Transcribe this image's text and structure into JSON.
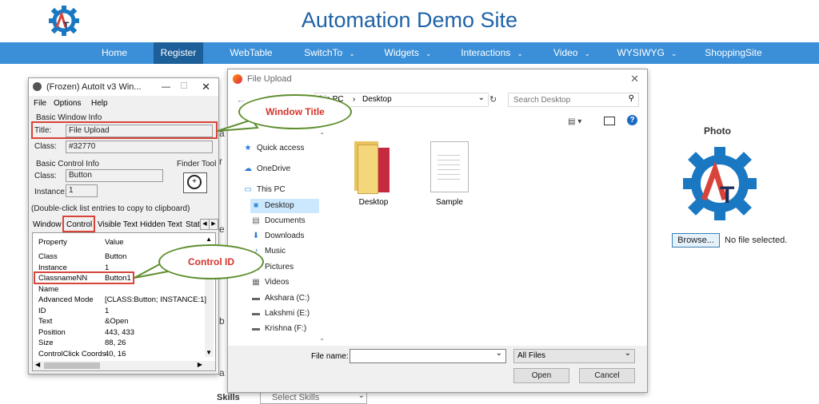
{
  "site": {
    "title": "Automation Demo Site",
    "logo_letters": "AT",
    "nav": [
      {
        "label": "Home",
        "chevron": false
      },
      {
        "label": "Register",
        "chevron": false
      },
      {
        "label": "WebTable",
        "chevron": false
      },
      {
        "label": "SwitchTo",
        "chevron": true
      },
      {
        "label": "Widgets",
        "chevron": true
      },
      {
        "label": "Interactions",
        "chevron": true
      },
      {
        "label": "Video",
        "chevron": true
      },
      {
        "label": "WYSIWYG",
        "chevron": true
      },
      {
        "label": "ShoppingSite",
        "chevron": false
      }
    ],
    "photo_label": "Photo",
    "browse_button": "Browse...",
    "no_file": "No file selected.",
    "skills_label": "Skills",
    "skills_select": "Select Skills"
  },
  "autoit": {
    "title": "(Frozen) AutoIt v3 Win...",
    "menu": [
      "File",
      "Options",
      "Help"
    ],
    "basic_window_info": "Basic Window Info",
    "title_label": "Title:",
    "title_value": "File Upload",
    "class_label": "Class:",
    "class_value": "#32770",
    "basic_control_info": "Basic Control Info",
    "ctrl_class_label": "Class:",
    "ctrl_class_value": "Button",
    "instance_label": "Instance:",
    "instance_value": "1",
    "finder_tool": "Finder Tool",
    "hint": "(Double-click list entries to copy to clipboard)",
    "tabs": [
      "Window",
      "Control",
      "Visible Text",
      "Hidden Text",
      "Stat"
    ],
    "col_property": "Property",
    "col_value": "Value",
    "rows": [
      {
        "property": "Class",
        "value": "Button"
      },
      {
        "property": "Instance",
        "value": "1"
      },
      {
        "property": "ClassnameNN",
        "value": "Button1"
      },
      {
        "property": "Name",
        "value": ""
      },
      {
        "property": "Advanced Mode",
        "value": "[CLASS:Button; INSTANCE:1]"
      },
      {
        "property": "ID",
        "value": "1"
      },
      {
        "property": "Text",
        "value": "&Open"
      },
      {
        "property": "Position",
        "value": "443, 433"
      },
      {
        "property": "Size",
        "value": "88, 26"
      },
      {
        "property": "ControlClick Coords",
        "value": "40, 16"
      }
    ]
  },
  "callouts": {
    "window_title": "Window Title",
    "control_id": "Control ID"
  },
  "dialog": {
    "title": "File Upload",
    "breadcrumb": [
      "This PC",
      "Desktop"
    ],
    "search_placeholder": "Search Desktop",
    "nav_items": [
      {
        "label": "Quick access",
        "icon": "star-icon"
      },
      {
        "label": "OneDrive",
        "icon": "cloud-icon"
      },
      {
        "label": "This PC",
        "icon": "computer-icon"
      },
      {
        "label": "Desktop",
        "icon": "desktop-icon"
      },
      {
        "label": "Documents",
        "icon": "document-icon"
      },
      {
        "label": "Downloads",
        "icon": "download-icon"
      },
      {
        "label": "Music",
        "icon": "music-icon"
      },
      {
        "label": "Pictures",
        "icon": "picture-icon"
      },
      {
        "label": "Videos",
        "icon": "video-icon"
      },
      {
        "label": "Akshara (C:)",
        "icon": "drive-icon"
      },
      {
        "label": "Lakshmi (E:)",
        "icon": "drive-icon"
      },
      {
        "label": "Krishna (F:)",
        "icon": "drive-icon"
      }
    ],
    "files": [
      {
        "name": "Desktop",
        "icon": "folder-icon"
      },
      {
        "name": "Sample",
        "icon": "text-file-icon"
      }
    ],
    "filename_label": "File name:",
    "filename_value": "",
    "filter_value": "All Files",
    "open_button": "Open",
    "cancel_button": "Cancel"
  },
  "colors": {
    "nav_bg": "#3a8fd8",
    "nav_active": "#1c5f99",
    "title_blue": "#1f63a8",
    "logo_blue": "#1a78c2",
    "logo_red": "#d8433a",
    "callout_border": "#5e8e2f",
    "callout_text": "#d4332a"
  }
}
